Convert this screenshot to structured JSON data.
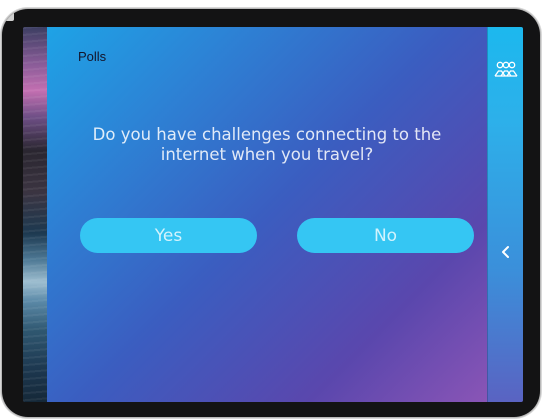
{
  "panel": {
    "title": "Polls",
    "question": "Do you have challenges connecting to the internet when you travel?",
    "answers": [
      {
        "label": "Yes"
      },
      {
        "label": "No"
      }
    ]
  },
  "sidebar": {
    "participants_icon": "participants-icon",
    "collapse_icon": "chevron-left-icon"
  },
  "colors": {
    "panel_gradient_start": "#1ea3e6",
    "panel_gradient_end": "#8a55b6",
    "button": "#35c6f3",
    "rail": "#1cb8ee"
  }
}
